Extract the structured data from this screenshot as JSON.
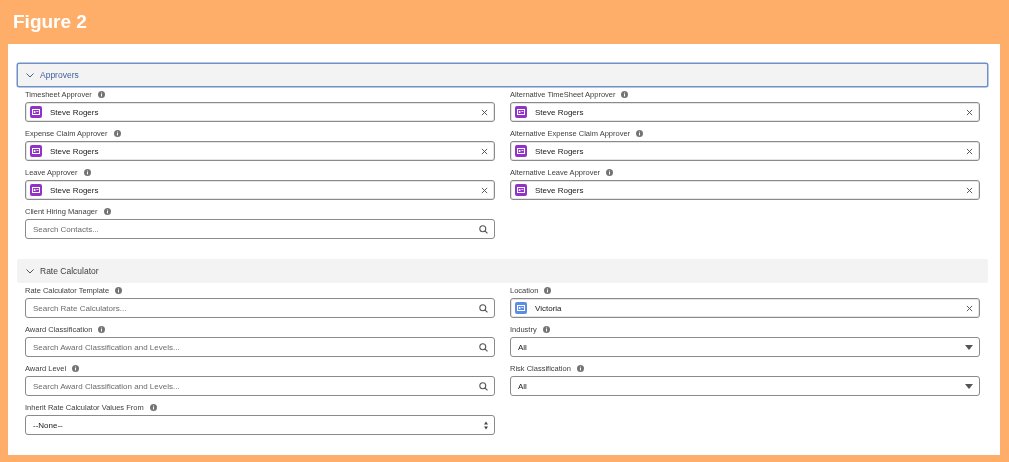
{
  "figure_title": "Figure 2",
  "sections": [
    {
      "title": "Approvers",
      "expanded": true,
      "focused": true,
      "columns": [
        [
          {
            "label": "Timesheet Approver",
            "kind": "lookup",
            "value": "Steve Rogers",
            "color": "#9232c9"
          },
          {
            "label": "Expense Claim Approver",
            "kind": "lookup",
            "value": "Steve Rogers",
            "color": "#9232c9"
          },
          {
            "label": "Leave Approver",
            "kind": "lookup",
            "value": "Steve Rogers",
            "color": "#9232c9"
          },
          {
            "label": "Client Hiring Manager",
            "kind": "search",
            "placeholder": "Search Contacts..."
          }
        ],
        [
          {
            "label": "Alternative TimeSheet Approver",
            "kind": "lookup",
            "value": "Steve Rogers",
            "color": "#9232c9"
          },
          {
            "label": "Alternative Expense Claim Approver",
            "kind": "lookup",
            "value": "Steve Rogers",
            "color": "#9232c9"
          },
          {
            "label": "Alternative Leave Approver",
            "kind": "lookup",
            "value": "Steve Rogers",
            "color": "#9232c9"
          }
        ]
      ]
    },
    {
      "title": "Rate Calculator",
      "expanded": true,
      "focused": false,
      "columns": [
        [
          {
            "label": "Rate Calculator Template",
            "kind": "search",
            "placeholder": "Search Rate Calculators..."
          },
          {
            "label": "Award Classification",
            "kind": "search",
            "placeholder": "Search Award Classification and Levels..."
          },
          {
            "label": "Award Level",
            "kind": "search",
            "placeholder": "Search Award Classification and Levels..."
          },
          {
            "label": "Inherit Rate Calculator Values From",
            "kind": "select",
            "value": "--None--"
          }
        ],
        [
          {
            "label": "Location",
            "kind": "lookup",
            "value": "Victoria",
            "color": "#5b8de3"
          },
          {
            "label": "Industry",
            "kind": "picklist",
            "value": "All"
          },
          {
            "label": "Risk Classification",
            "kind": "picklist",
            "value": "All"
          }
        ]
      ]
    }
  ]
}
